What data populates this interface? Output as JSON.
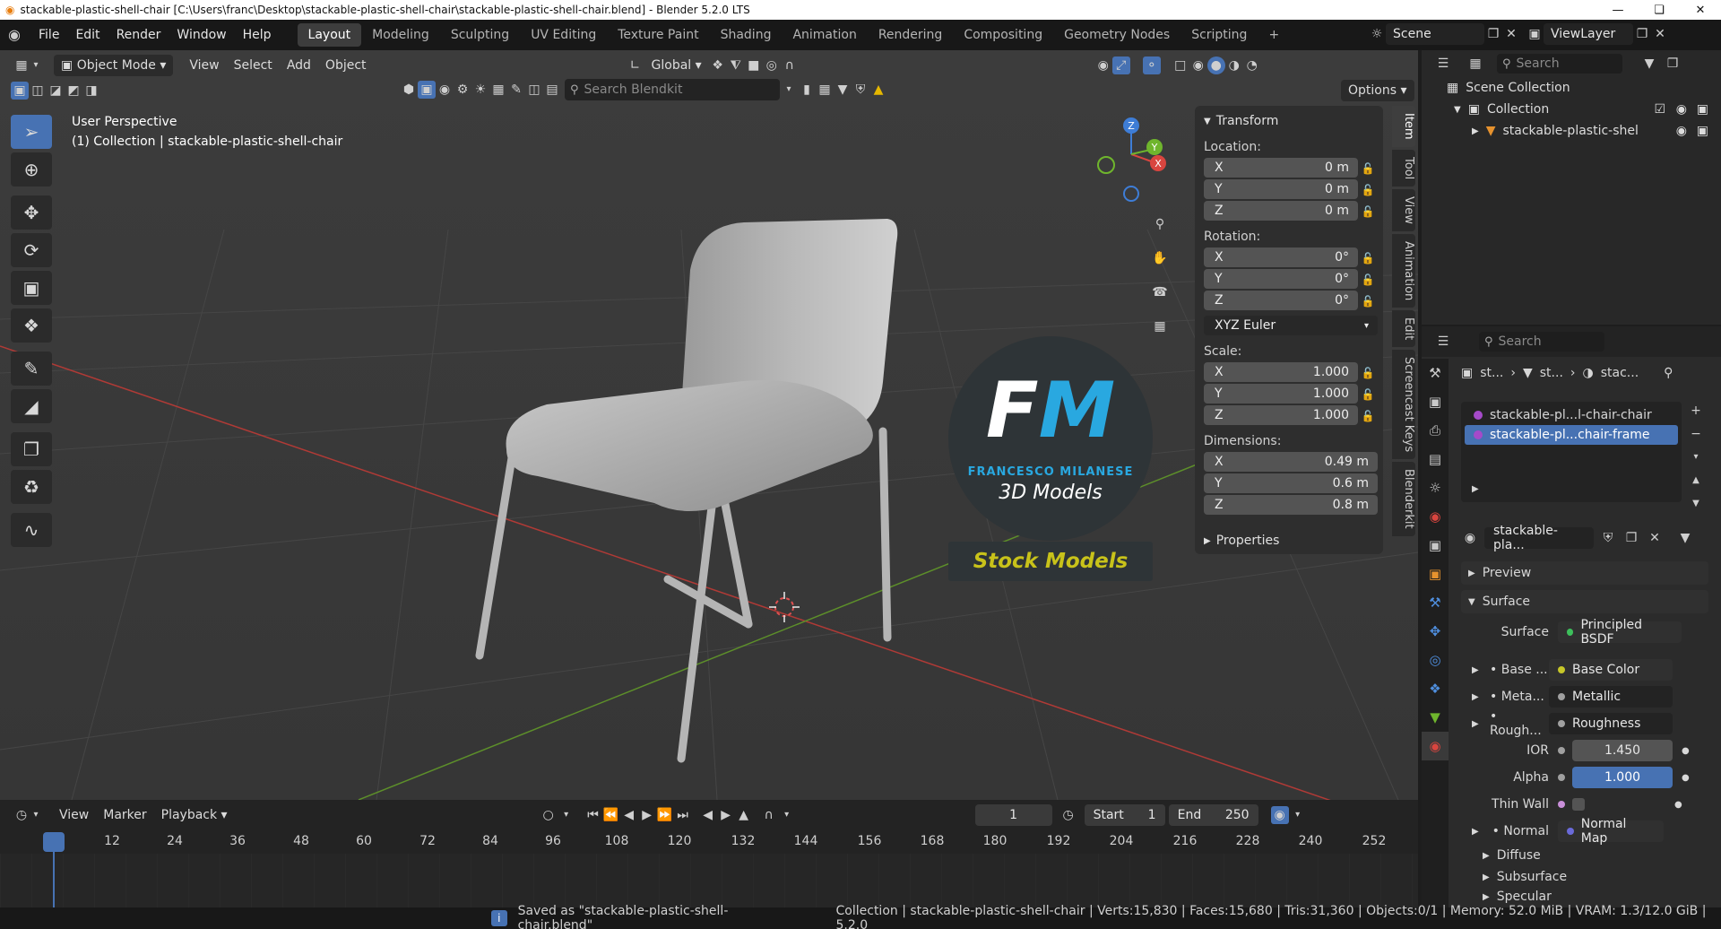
{
  "titlebar": {
    "title": "stackable-plastic-shell-chair [C:\\Users\\franc\\Desktop\\stackable-plastic-shell-chair\\stackable-plastic-shell-chair.blend] - Blender 5.2.0 LTS",
    "minimize": "—",
    "maximize": "❏",
    "close": "✕"
  },
  "menu": [
    "File",
    "Edit",
    "Render",
    "Window",
    "Help"
  ],
  "workspaces": [
    "Layout",
    "Modeling",
    "Sculpting",
    "UV Editing",
    "Texture Paint",
    "Shading",
    "Animation",
    "Rendering",
    "Compositing",
    "Geometry Nodes",
    "Scripting"
  ],
  "active_workspace": "Layout",
  "scene": {
    "name": "Scene",
    "view_layer": "ViewLayer"
  },
  "viewport_header": {
    "mode": "Object Mode",
    "menus": [
      "View",
      "Select",
      "Add",
      "Object"
    ],
    "orientation": "Global",
    "search_placeholder": "Search Blendkit",
    "options_label": "Options"
  },
  "viewport_overlay": {
    "perspective": "User Perspective",
    "collection_info": "(1) Collection | stackable-plastic-shell-chair"
  },
  "gizmo": {
    "x": "X",
    "y": "Y",
    "z": "Z"
  },
  "watermark": {
    "logo": "FM",
    "name": "FRANCESCO MILANESE",
    "tagline": "3D Models",
    "banner": "Stock Models"
  },
  "transform_panel": {
    "title": "Transform",
    "location_label": "Location:",
    "location": [
      {
        "axis": "X",
        "value": "0 m"
      },
      {
        "axis": "Y",
        "value": "0 m"
      },
      {
        "axis": "Z",
        "value": "0 m"
      }
    ],
    "rotation_label": "Rotation:",
    "rotation": [
      {
        "axis": "X",
        "value": "0°"
      },
      {
        "axis": "Y",
        "value": "0°"
      },
      {
        "axis": "Z",
        "value": "0°"
      }
    ],
    "rotation_mode": "XYZ Euler",
    "scale_label": "Scale:",
    "scale": [
      {
        "axis": "X",
        "value": "1.000"
      },
      {
        "axis": "Y",
        "value": "1.000"
      },
      {
        "axis": "Z",
        "value": "1.000"
      }
    ],
    "dimensions_label": "Dimensions:",
    "dimensions": [
      {
        "axis": "X",
        "value": "0.49 m"
      },
      {
        "axis": "Y",
        "value": "0.6 m"
      },
      {
        "axis": "Z",
        "value": "0.8 m"
      }
    ],
    "properties_label": "Properties"
  },
  "side_tabs": [
    "Item",
    "Tool",
    "View",
    "Animation",
    "Edit",
    "Screencast Keys",
    "Blenderkit"
  ],
  "outliner": {
    "search_placeholder": "Search",
    "scene_collection": "Scene Collection",
    "collection": "Collection",
    "object": "stackable-plastic-shel"
  },
  "properties": {
    "search_placeholder": "Search",
    "breadcrumb": [
      "st...",
      "st...",
      "stac..."
    ],
    "material_slots": [
      "stackable-pl...l-chair-chair",
      "stackable-pl...chair-frame"
    ],
    "material_name": "stackable-pla...",
    "preview_label": "Preview",
    "surface_label": "Surface",
    "surface_row_label": "Surface",
    "surface_shader": "Principled BSDF",
    "inputs": [
      {
        "label": "Base ...",
        "value": "Base Color",
        "dot": "#c7c729"
      },
      {
        "label": "Meta...",
        "value": "Metallic",
        "dot": "#a0a0a0"
      },
      {
        "label": "Rough...",
        "value": "Roughness",
        "dot": "#a0a0a0"
      }
    ],
    "ior_label": "IOR",
    "ior_value": "1.450",
    "alpha_label": "Alpha",
    "alpha_value": "1.000",
    "thin_wall_label": "Thin Wall",
    "normal_label": "Normal",
    "normal_value": "Normal Map",
    "subsections": [
      "Diffuse",
      "Subsurface",
      "Specular"
    ]
  },
  "timeline": {
    "menus": [
      "View",
      "Marker",
      "Playback"
    ],
    "current_frame": "1",
    "start_label": "Start",
    "start_value": "1",
    "end_label": "End",
    "end_value": "250",
    "ruler": [
      "1",
      "12",
      "24",
      "36",
      "48",
      "60",
      "72",
      "84",
      "96",
      "108",
      "120",
      "132",
      "144",
      "156",
      "168",
      "180",
      "192",
      "204",
      "216",
      "228",
      "240",
      "252"
    ]
  },
  "statusbar": {
    "message": "Saved as \"stackable-plastic-shell-chair.blend\"",
    "stats": "Collection | stackable-plastic-shell-chair | Verts:15,830 | Faces:15,680 | Tris:31,360 | Objects:0/1 | Memory: 52.0 MiB | VRAM: 1.3/12.0 GiB | 5.2.0"
  },
  "colors": {
    "accent": "#4772b3",
    "watermark_blue": "#29a8e0",
    "banner_text": "#c8c21a",
    "x_axis": "#d9453f",
    "y_axis": "#6fb52d",
    "z_axis": "#3e7dd6"
  }
}
